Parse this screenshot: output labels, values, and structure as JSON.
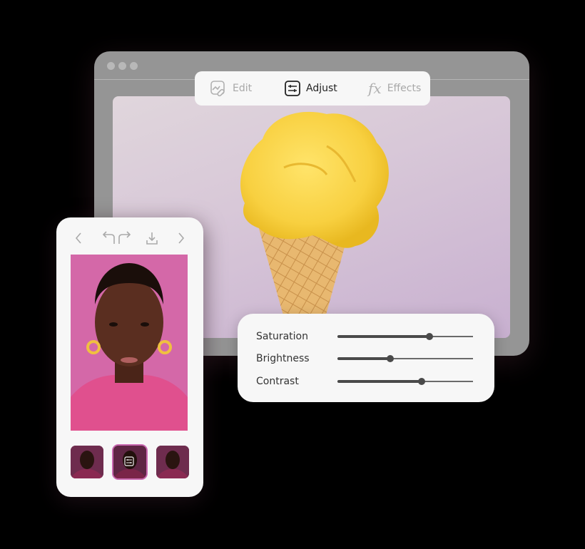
{
  "toolbar": {
    "tabs": [
      {
        "label": "Edit",
        "icon": "image-edit-icon",
        "active": false
      },
      {
        "label": "Adjust",
        "icon": "sliders-icon",
        "active": true
      },
      {
        "label": "Effects",
        "icon": "fx-icon",
        "glyph": "fx",
        "active": false
      }
    ]
  },
  "main_photo": {
    "subject": "yellow ice cream cone"
  },
  "adjustments": {
    "rows": [
      {
        "label": "Saturation",
        "value": 0.68
      },
      {
        "label": "Brightness",
        "value": 0.39
      },
      {
        "label": "Contrast",
        "value": 0.62
      }
    ]
  },
  "phone": {
    "nav": [
      "back",
      "undo",
      "redo",
      "download",
      "forward"
    ],
    "photo_subject": "portrait, pink background",
    "thumbnails": [
      {
        "selected": false
      },
      {
        "selected": true,
        "icon": "sliders-icon"
      },
      {
        "selected": false
      }
    ]
  },
  "colors": {
    "accent": "#c868b0",
    "panel": "#f7f7f7",
    "frame": "#959595"
  }
}
